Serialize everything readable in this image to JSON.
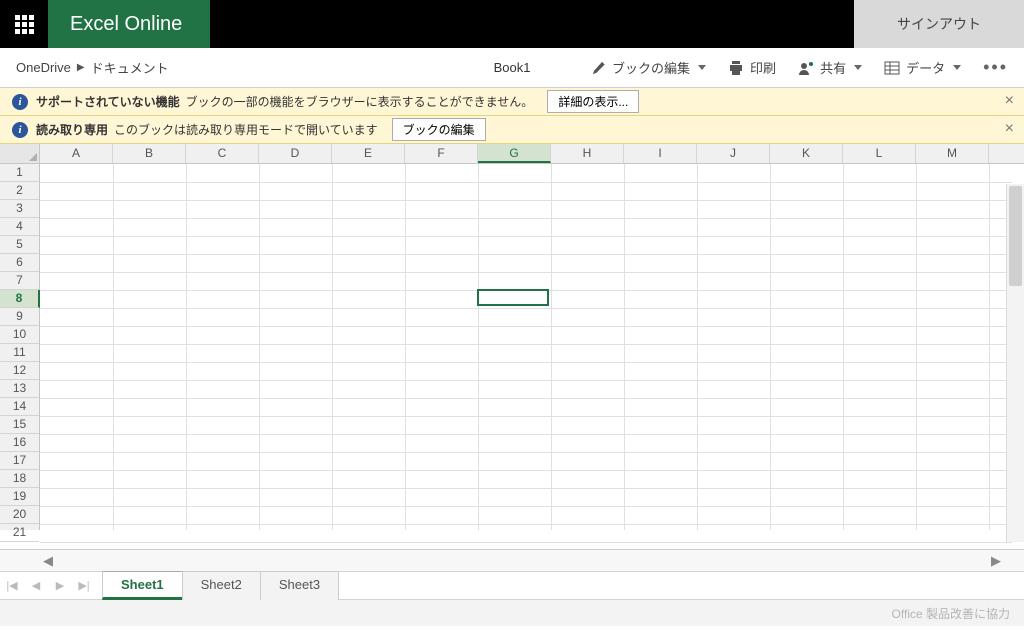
{
  "header": {
    "app_name": "Excel Online",
    "sign_out": "サインアウト"
  },
  "breadcrumb": {
    "root": "OneDrive",
    "folder": "ドキュメント"
  },
  "document": {
    "title": "Book1"
  },
  "commands": {
    "edit_workbook": "ブックの編集",
    "print": "印刷",
    "share": "共有",
    "data": "データ"
  },
  "messages": {
    "unsupported_title": "サポートされていない機能",
    "unsupported_text": "ブックの一部の機能をブラウザーに表示することができません。",
    "details_btn": "詳細の表示...",
    "readonly_title": "読み取り専用",
    "readonly_text": "このブックは読み取り専用モードで開いています",
    "edit_btn": "ブックの編集"
  },
  "grid": {
    "columns": [
      "A",
      "B",
      "C",
      "D",
      "E",
      "F",
      "G",
      "H",
      "I",
      "J",
      "K",
      "L",
      "M"
    ],
    "row_count": 21,
    "selected_col": "G",
    "selected_row": 8
  },
  "sheets": {
    "tabs": [
      "Sheet1",
      "Sheet2",
      "Sheet3"
    ],
    "active": 0
  },
  "status": {
    "feedback": "Office 製品改善に協力"
  }
}
